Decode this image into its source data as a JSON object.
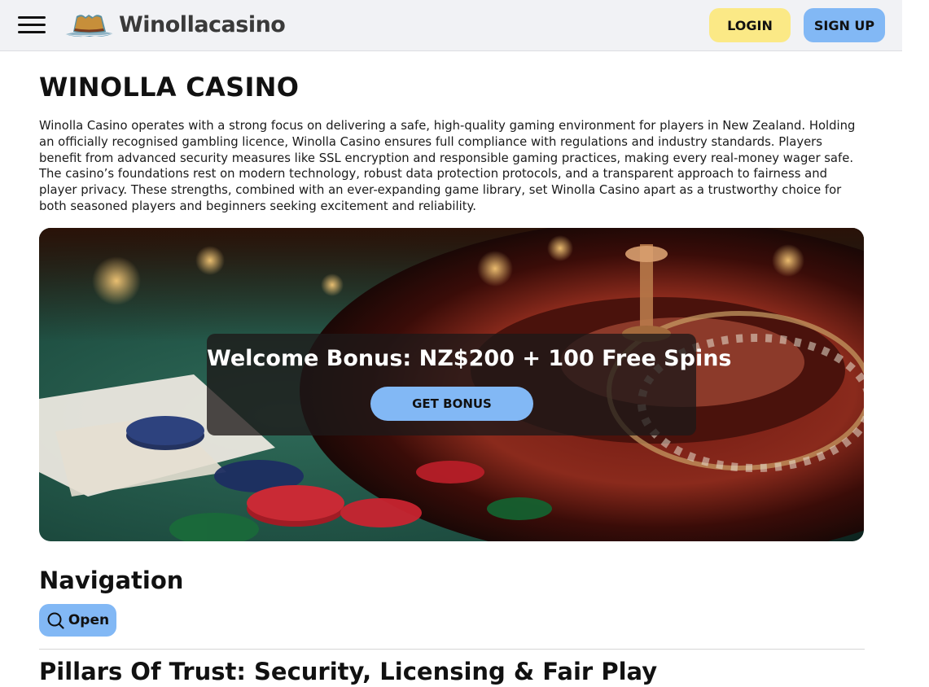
{
  "header": {
    "menu_icon": "hamburger-menu-icon",
    "logo_icon": "cowboy-hat-icon",
    "logo_text": "Winollacasino",
    "login_label": "LOGIN",
    "signup_label": "SIGN UP"
  },
  "main": {
    "title": "WINOLLA CASINO",
    "intro": "Winolla Casino operates with a strong focus on delivering a safe, high-quality gaming environment for players in New Zealand. Holding an officially recognised gambling licence, Winolla Casino ensures full compliance with regulations and industry standards. Players benefit from advanced security measures like SSL encryption and responsible gaming practices, making every real-money wager safe. The casino’s foundations rest on modern technology, robust data protection protocols, and a transparent approach to fairness and player privacy. These strengths, combined with an ever-expanding game library, set Winolla Casino apart as a trustworthy choice for both seasoned players and beginners seeking excitement and reliability.",
    "hero": {
      "promo_title": "Welcome Bonus: NZ$200 + 100 Free Spins",
      "cta_label": "GET BONUS"
    },
    "navigation": {
      "title": "Navigation",
      "open_label": "Open",
      "open_icon": "search-icon"
    },
    "section_title": "Pillars Of Trust: Security, Licensing & Fair Play"
  },
  "colors": {
    "header_bg": "#f1f2f5",
    "login_bg": "#fbe986",
    "signup_bg": "#82b8f5",
    "accent_blue": "#82b8f5"
  }
}
